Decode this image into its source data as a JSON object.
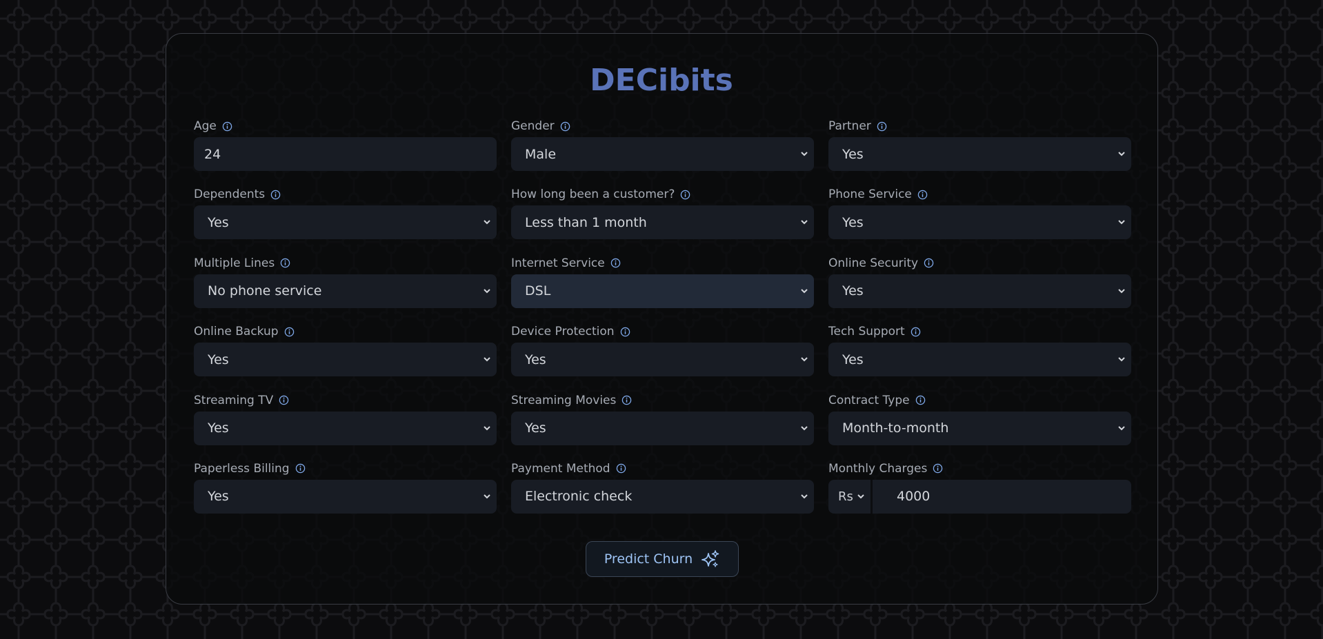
{
  "app": {
    "title": "DECibits"
  },
  "colors": {
    "title": "#5a73b8",
    "accent": "#7fa8e8",
    "field_bg": "#181c24",
    "field_bg_focus": "#222a38"
  },
  "icons": {
    "info": "info-icon",
    "chevron": "chevron-down-icon",
    "sparkle": "sparkles-icon"
  },
  "form": {
    "age": {
      "label": "Age",
      "value": "24"
    },
    "gender": {
      "label": "Gender",
      "value": "Male"
    },
    "partner": {
      "label": "Partner",
      "value": "Yes"
    },
    "dependents": {
      "label": "Dependents",
      "value": "Yes"
    },
    "tenure": {
      "label": "How long been a customer?",
      "value": "Less than 1 month"
    },
    "phone_service": {
      "label": "Phone Service",
      "value": "Yes"
    },
    "multiple_lines": {
      "label": "Multiple Lines",
      "value": "No phone service"
    },
    "internet_service": {
      "label": "Internet Service",
      "value": "DSL"
    },
    "online_security": {
      "label": "Online Security",
      "value": "Yes"
    },
    "online_backup": {
      "label": "Online Backup",
      "value": "Yes"
    },
    "device_protection": {
      "label": "Device Protection",
      "value": "Yes"
    },
    "tech_support": {
      "label": "Tech Support",
      "value": "Yes"
    },
    "streaming_tv": {
      "label": "Streaming TV",
      "value": "Yes"
    },
    "streaming_movies": {
      "label": "Streaming Movies",
      "value": "Yes"
    },
    "contract_type": {
      "label": "Contract Type",
      "value": "Month-to-month"
    },
    "paperless_billing": {
      "label": "Paperless Billing",
      "value": "Yes"
    },
    "payment_method": {
      "label": "Payment Method",
      "value": "Electronic check"
    },
    "monthly_charges": {
      "label": "Monthly Charges",
      "currency": "Rs",
      "value": "4000"
    }
  },
  "actions": {
    "predict_label": "Predict Churn"
  }
}
